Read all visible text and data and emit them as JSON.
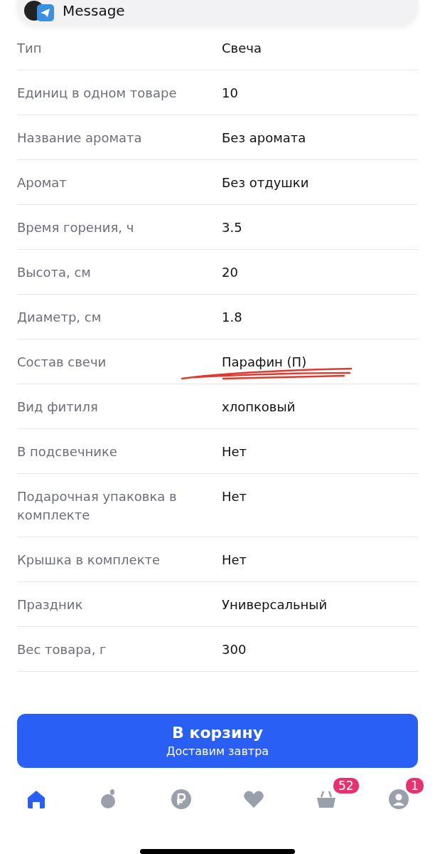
{
  "notification": {
    "text": "Message"
  },
  "specs": [
    {
      "label": "Тип",
      "value": "Свеча"
    },
    {
      "label": "Единиц в одном товаре",
      "value": "10"
    },
    {
      "label": "Название аромата",
      "value": "Без аромата"
    },
    {
      "label": "Аромат",
      "value": "Без отдушки"
    },
    {
      "label": "Время горения, ч",
      "value": "3.5"
    },
    {
      "label": "Высота, см",
      "value": "20"
    },
    {
      "label": "Диаметр, см",
      "value": "1.8"
    },
    {
      "label": "Состав свечи",
      "value": "Парафин (П)",
      "marked": true
    },
    {
      "label": "Вид фитиля",
      "value": "хлопковый"
    },
    {
      "label": "В подсвечнике",
      "value": "Нет"
    },
    {
      "label": "Подарочная упаковка в комплекте",
      "value": "Нет"
    },
    {
      "label": "Крышка в комплекте",
      "value": "Нет"
    },
    {
      "label": "Праздник",
      "value": "Универсальный"
    },
    {
      "label": "Вес товара, г",
      "value": "300"
    }
  ],
  "cart_button": {
    "label": "В корзину",
    "sublabel": "Доставим завтра"
  },
  "nav": [
    {
      "kind": "home",
      "selected": true
    },
    {
      "kind": "fruit",
      "selected": false
    },
    {
      "kind": "ruble",
      "selected": false
    },
    {
      "kind": "heart",
      "selected": false
    },
    {
      "kind": "basket",
      "selected": false,
      "badge": "52"
    },
    {
      "kind": "profile",
      "selected": false,
      "badge": "1"
    }
  ]
}
